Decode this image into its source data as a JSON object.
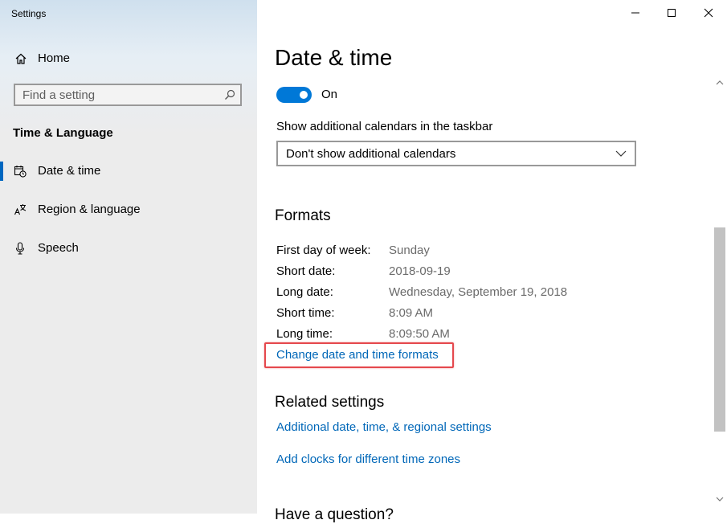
{
  "window": {
    "app_title": "Settings",
    "controls": {
      "minimize": "minimize-icon",
      "maximize": "maximize-icon",
      "close": "close-icon"
    }
  },
  "sidebar": {
    "home_label": "Home",
    "search": {
      "placeholder": "Find a setting",
      "value": ""
    },
    "section_heading": "Time & Language",
    "items": [
      {
        "label": "Date & time",
        "icon": "calendar-clock-icon",
        "active": true
      },
      {
        "label": "Region & language",
        "icon": "region-language-icon",
        "active": false
      },
      {
        "label": "Speech",
        "icon": "microphone-icon",
        "active": false
      }
    ]
  },
  "main": {
    "title": "Date & time",
    "toggle": {
      "state_label": "On",
      "on": true
    },
    "calendar": {
      "label": "Show additional calendars in the taskbar",
      "selected": "Don't show additional calendars"
    },
    "formats": {
      "heading": "Formats",
      "rows": [
        {
          "key": "First day of week:",
          "value": "Sunday"
        },
        {
          "key": "Short date:",
          "value": "2018-09-19"
        },
        {
          "key": "Long date:",
          "value": "Wednesday, September 19, 2018"
        },
        {
          "key": "Short time:",
          "value": "8:09 AM"
        },
        {
          "key": "Long time:",
          "value": "8:09:50 AM"
        }
      ],
      "change_link": "Change date and time formats"
    },
    "related": {
      "heading": "Related settings",
      "links": [
        "Additional date, time, & regional settings",
        "Add clocks for different time zones"
      ]
    },
    "next_heading_partial": "Have a question?"
  },
  "colors": {
    "accent": "#0078d7",
    "link": "#0067b8",
    "highlight": "#e5484d"
  }
}
